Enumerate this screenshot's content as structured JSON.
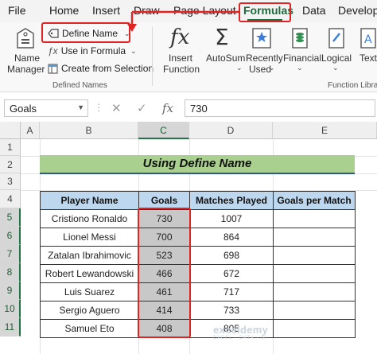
{
  "tabs": [
    "File",
    "Home",
    "Insert",
    "Draw",
    "Page Layout",
    "Formulas",
    "Data",
    "Developer"
  ],
  "active_tab": "Formulas",
  "ribbon": {
    "name_manager": [
      "Name",
      "Manager"
    ],
    "define_name": "Define Name",
    "use_in_formula": "Use in Formula",
    "create_from_selection": "Create from Selection",
    "defined_names_group": "Defined Names",
    "insert_function": [
      "Insert",
      "Function"
    ],
    "autosum": "AutoSum",
    "recently_used": [
      "Recently",
      "Used"
    ],
    "financial": "Financial",
    "logical": "Logical",
    "text": "Text",
    "function_library_group": "Function Librar"
  },
  "formula_bar": {
    "name_box": "Goals",
    "cancel": "✕",
    "enter": "✓",
    "fx": "fx",
    "value": "730"
  },
  "columns": [
    "A",
    "B",
    "C",
    "D",
    "E"
  ],
  "selected_column": "C",
  "rows": [
    "1",
    "2",
    "3",
    "4",
    "5",
    "6",
    "7",
    "8",
    "9",
    "10",
    "11"
  ],
  "sheet_title": "Using Define Name",
  "table": {
    "headers": [
      "Player Name",
      "Goals",
      "Matches Played",
      "Goals per Match"
    ],
    "rows": [
      [
        "Cristiono Ronaldo",
        "730",
        "1007",
        ""
      ],
      [
        "Lionel Messi",
        "700",
        "864",
        ""
      ],
      [
        "Zatalan Ibrahimovic",
        "523",
        "698",
        ""
      ],
      [
        "Robert Lewandowski",
        "466",
        "672",
        ""
      ],
      [
        "Luis Suarez",
        "461",
        "717",
        ""
      ],
      [
        "Sergio Aguero",
        "414",
        "733",
        ""
      ],
      [
        "Samuel Eto",
        "408",
        "805",
        ""
      ]
    ]
  },
  "watermark": {
    "brand": "exceldemy",
    "tagline": "EXCEL · DATA · BI"
  },
  "colors": {
    "accent_green": "#217346",
    "highlight_red": "#e02424",
    "title_fill": "#a9d08e",
    "header_fill": "#bdd7ee",
    "goals_fill": "#c8c8c8"
  }
}
